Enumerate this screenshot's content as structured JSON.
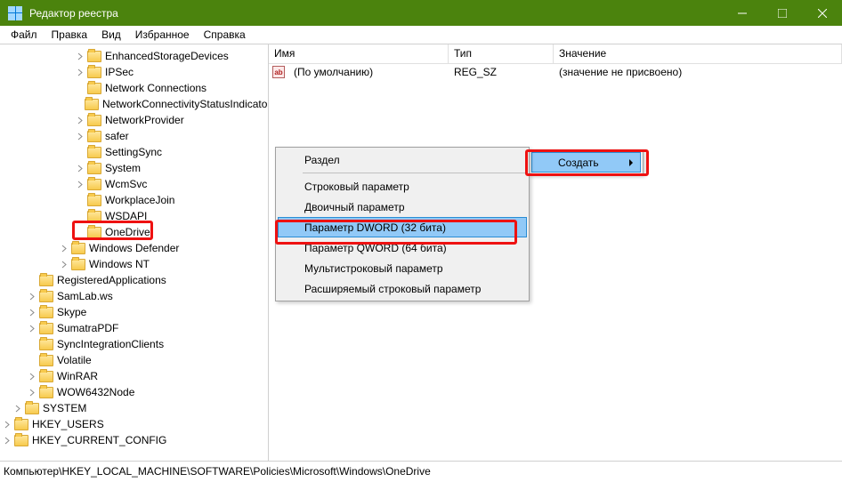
{
  "window": {
    "title": "Редактор реестра"
  },
  "menu": {
    "file": "Файл",
    "edit": "Правка",
    "view": "Вид",
    "favorites": "Избранное",
    "help": "Справка"
  },
  "tree": {
    "items": [
      {
        "indent": 5,
        "exp": "closed",
        "label": "EnhancedStorageDevices"
      },
      {
        "indent": 5,
        "exp": "closed",
        "label": "IPSec"
      },
      {
        "indent": 5,
        "exp": "none",
        "label": "Network Connections"
      },
      {
        "indent": 5,
        "exp": "none",
        "label": "NetworkConnectivityStatusIndicator"
      },
      {
        "indent": 5,
        "exp": "closed",
        "label": "NetworkProvider"
      },
      {
        "indent": 5,
        "exp": "closed",
        "label": "safer"
      },
      {
        "indent": 5,
        "exp": "none",
        "label": "SettingSync"
      },
      {
        "indent": 5,
        "exp": "closed",
        "label": "System"
      },
      {
        "indent": 5,
        "exp": "closed",
        "label": "WcmSvc"
      },
      {
        "indent": 5,
        "exp": "none",
        "label": "WorkplaceJoin"
      },
      {
        "indent": 5,
        "exp": "none",
        "label": "WSDAPI"
      },
      {
        "indent": 5,
        "exp": "none",
        "label": "OneDrive"
      },
      {
        "indent": 4,
        "exp": "closed",
        "label": "Windows Defender"
      },
      {
        "indent": 4,
        "exp": "closed",
        "label": "Windows NT"
      },
      {
        "indent": 2,
        "exp": "none",
        "label": "RegisteredApplications"
      },
      {
        "indent": 2,
        "exp": "closed",
        "label": "SamLab.ws"
      },
      {
        "indent": 2,
        "exp": "closed",
        "label": "Skype"
      },
      {
        "indent": 2,
        "exp": "closed",
        "label": "SumatraPDF"
      },
      {
        "indent": 2,
        "exp": "none",
        "label": "SyncIntegrationClients"
      },
      {
        "indent": 2,
        "exp": "none",
        "label": "Volatile"
      },
      {
        "indent": 2,
        "exp": "closed",
        "label": "WinRAR"
      },
      {
        "indent": 2,
        "exp": "closed",
        "label": "WOW6432Node"
      },
      {
        "indent": 1,
        "exp": "closed",
        "label": "SYSTEM"
      },
      {
        "indent": 0,
        "exp": "closed",
        "label": "HKEY_USERS"
      },
      {
        "indent": 0,
        "exp": "closed",
        "label": "HKEY_CURRENT_CONFIG"
      }
    ]
  },
  "list": {
    "col_name": "Имя",
    "col_type": "Тип",
    "col_value": "Значение",
    "rows": [
      {
        "name": "(По умолчанию)",
        "type": "REG_SZ",
        "value": "(значение не присвоено)"
      }
    ]
  },
  "context": {
    "create": "Создать",
    "section": "Раздел",
    "string": "Строковый параметр",
    "binary": "Двоичный параметр",
    "dword": "Параметр DWORD (32 бита)",
    "qword": "Параметр QWORD (64 бита)",
    "multistring": "Мультистроковый параметр",
    "expandstring": "Расширяемый строковый параметр"
  },
  "status": "Компьютер\\HKEY_LOCAL_MACHINE\\SOFTWARE\\Policies\\Microsoft\\Windows\\OneDrive"
}
